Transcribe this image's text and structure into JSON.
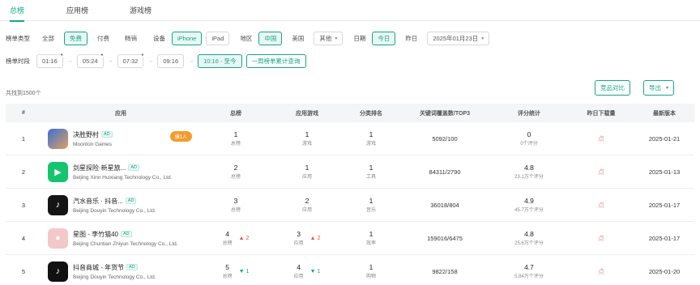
{
  "tabs": [
    "总榜",
    "应用榜",
    "游戏榜"
  ],
  "filters": {
    "type_label": "榜单类型",
    "types": [
      "全部",
      "免费",
      "付费",
      "畅销"
    ],
    "device_label": "设备",
    "devices": [
      "iPhone",
      "iPad"
    ],
    "region_label": "地区",
    "regions": [
      "中国",
      "美国"
    ],
    "region_more": "其他",
    "date_label": "日期",
    "dates": [
      "今日",
      "昨日"
    ],
    "date_value": "2025年01月23日",
    "time_label": "榜单时段",
    "times": [
      "01:16",
      "05:24",
      "07:32",
      "09:16"
    ],
    "time_current": "10:16 - 至今",
    "range_btn": "一周榜单累计查询"
  },
  "found_text": "共找到1500个",
  "compare_btn": "竞品对比",
  "export_btn": "导出",
  "table": {
    "headers": [
      "#",
      "应用",
      "总榜",
      "应用游戏",
      "分类排名",
      "关键词覆盖数/TOP3",
      "评分统计",
      "昨日下载量",
      "最新版本"
    ],
    "rows": [
      {
        "idx": "1",
        "name": "决胜野村",
        "dev": "Moonton Games",
        "badge": "爆1人",
        "total": "1",
        "total_sub": "总榜",
        "total_chg": "",
        "cat": "1",
        "cat_sub": "游戏",
        "cat_chg": "",
        "sub": "1",
        "sub_sub": "游戏",
        "kw": "5092/100",
        "score": "0",
        "score_sub": "0个评分",
        "dl": "点",
        "ver": "2025-01-21"
      },
      {
        "idx": "2",
        "name": "剑星探险·新星旅...",
        "dev": "Beijing Xinn Huixiang Technology Co., Ltd.",
        "badge": "",
        "total": "2",
        "total_sub": "总榜",
        "total_chg": "",
        "cat": "1",
        "cat_sub": "应用",
        "cat_chg": "",
        "sub": "1",
        "sub_sub": "工具",
        "kw": "84311/2790",
        "score": "4.8",
        "score_sub": "23.1万个评分",
        "dl": "点",
        "ver": "2025-01-13"
      },
      {
        "idx": "3",
        "name": "汽水音乐 · 抖音...",
        "dev": "Beijing Douyin Technology Co., Ltd.",
        "badge": "",
        "total": "3",
        "total_sub": "总榜",
        "total_chg": "",
        "cat": "2",
        "cat_sub": "应用",
        "cat_chg": "",
        "sub": "1",
        "sub_sub": "音乐",
        "kw": "36018/804",
        "score": "4.9",
        "score_sub": "45.7万个评分",
        "dl": "点",
        "ver": "2025-01-17"
      },
      {
        "idx": "4",
        "name": "星图 - 李竹猫40",
        "dev": "Beijing Chuntian Zhiyun Technology Co., Ltd.",
        "badge": "",
        "total": "4",
        "total_sub": "总榜",
        "total_chg": "2",
        "cat": "3",
        "cat_sub": "应用",
        "cat_chg": "2",
        "sub": "1",
        "sub_sub": "效率",
        "kw": "159016/6475",
        "score": "4.8",
        "score_sub": "25.6万个评分",
        "dl": "点",
        "ver": "2025-01-17"
      },
      {
        "idx": "5",
        "name": "抖音商城 - 年货节",
        "dev": "Beijing Douyin Technology Co., Ltd.",
        "badge": "",
        "total": "5",
        "total_sub": "总榜",
        "total_chg": "1",
        "cat": "4",
        "cat_sub": "应用",
        "cat_chg": "1",
        "sub": "1",
        "sub_sub": "购物",
        "kw": "9822/158",
        "score": "4.7",
        "score_sub": "5.84万个评分",
        "dl": "点",
        "ver": "2025-01-20"
      }
    ]
  },
  "colors": {
    "accent": "#14a58b",
    "badge": "#f39c2c",
    "up": "#e8544a",
    "down": "#14a58b"
  }
}
